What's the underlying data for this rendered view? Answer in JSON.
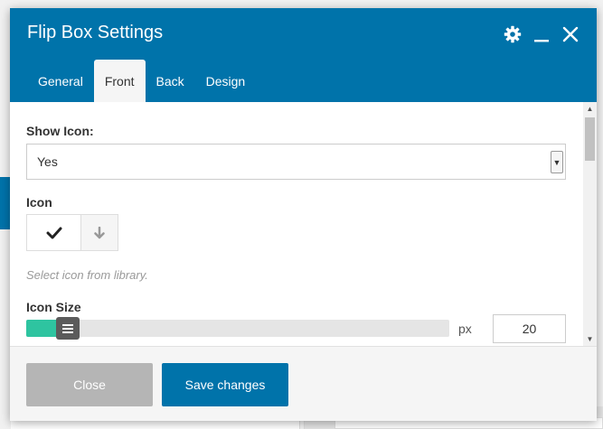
{
  "modal": {
    "title": "Flip Box Settings"
  },
  "header_icons": [
    "gear-icon",
    "minimize-icon",
    "close-icon"
  ],
  "tabs": [
    {
      "label": "General",
      "active": false
    },
    {
      "label": "Front",
      "active": true
    },
    {
      "label": "Back",
      "active": false
    },
    {
      "label": "Design",
      "active": false
    }
  ],
  "fields": {
    "show_icon": {
      "label": "Show Icon:",
      "value": "Yes"
    },
    "icon": {
      "label": "Icon",
      "selected_icon": "checkmark-icon",
      "action_icon": "arrow-down-icon",
      "hint": "Select icon from library."
    },
    "icon_size": {
      "label": "Icon Size",
      "value": "20",
      "unit": "px",
      "slider_fraction": 0.07
    }
  },
  "footer": {
    "close_label": "Close",
    "save_label": "Save changes"
  },
  "colors": {
    "header": "#0073aa",
    "slider_fill": "#2ec4a0",
    "close_button": "#b5b5b5",
    "save_button": "#0073aa"
  }
}
